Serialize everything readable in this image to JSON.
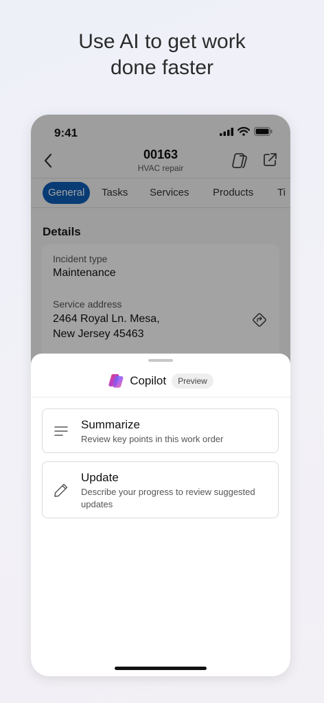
{
  "headline": {
    "line1": "Use AI to get work",
    "line2": "done faster"
  },
  "status_bar": {
    "time": "9:41"
  },
  "nav": {
    "title": "00163",
    "subtitle": "HVAC repair"
  },
  "tabs": [
    {
      "label": "General",
      "active": true
    },
    {
      "label": "Tasks",
      "active": false
    },
    {
      "label": "Services",
      "active": false
    },
    {
      "label": "Products",
      "active": false
    },
    {
      "label": "Ti",
      "active": false
    }
  ],
  "details": {
    "section_title": "Details",
    "incident_type_label": "Incident type",
    "incident_type_value": "Maintenance",
    "service_address_label": "Service address",
    "service_address_line1": "2464 Royal Ln. Mesa,",
    "service_address_line2": "New Jersey 45463"
  },
  "copilot_sheet": {
    "title": "Copilot",
    "badge": "Preview",
    "options": [
      {
        "title": "Summarize",
        "description": "Review key points in this work order",
        "icon": "lines-icon"
      },
      {
        "title": "Update",
        "description": "Describe your progress to review suggested updates",
        "icon": "pencil-icon"
      }
    ]
  },
  "colors": {
    "accent": "#0f5fb8",
    "overlay": "rgba(0,0,0,0.36)"
  }
}
